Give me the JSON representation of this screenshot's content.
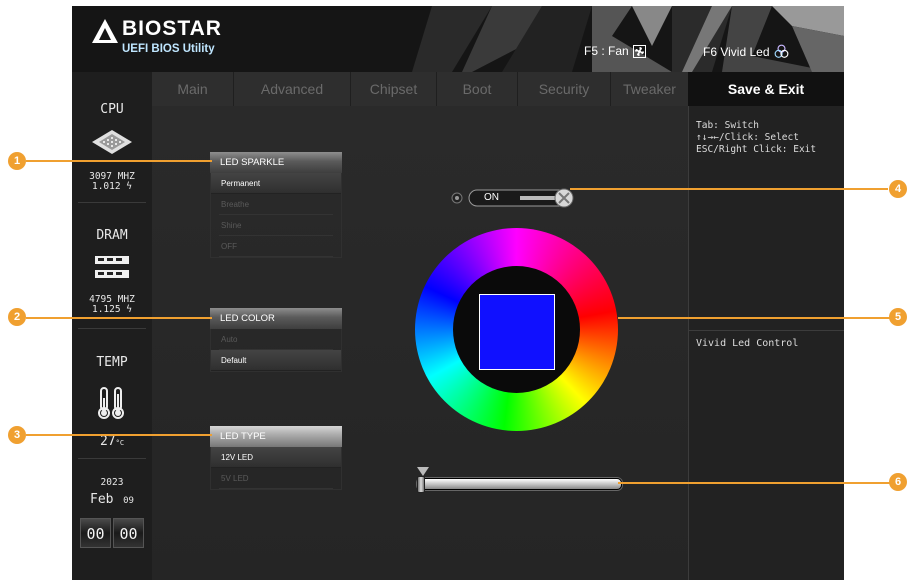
{
  "header": {
    "brand": "BIOSTAR",
    "subtitle": "UEFI BIOS Utility",
    "hotkey_fan": "F5 : Fan",
    "hotkey_led": "F6  Vivid Led"
  },
  "sidebar": {
    "cpu_title": "CPU",
    "cpu_freq": "3097 MHZ",
    "cpu_volt": "1.012 ϟ",
    "dram_title": "DRAM",
    "dram_freq": "4795 MHZ",
    "dram_volt": "1.125 ϟ",
    "temp_title": "TEMP",
    "temp_value": "27",
    "temp_unit": "°C",
    "year": "2023",
    "month": "Feb",
    "day": "09",
    "clock_hours": "00",
    "clock_minutes": "00"
  },
  "tabs": [
    "Main",
    "Advanced",
    "Chipset",
    "Boot",
    "Security",
    "Tweaker"
  ],
  "active_tab": "Save & Exit",
  "help": {
    "lines": "Tab: Switch\n↑↓→←/Click: Select\nESC/Right Click: Exit",
    "description": "Vivid Led Control"
  },
  "led_sparkle": {
    "label": "LED SPARKLE",
    "options": [
      "Permanent",
      "Breathe",
      "Shine",
      "OFF"
    ],
    "selected": "Permanent"
  },
  "led_color": {
    "label": "LED COLOR",
    "options": [
      "Auto",
      "Default"
    ],
    "selected": "Default"
  },
  "led_type": {
    "label": "LED TYPE",
    "options": [
      "12V LED",
      "5V LED"
    ],
    "selected": "12V LED"
  },
  "toggle": {
    "label": "ON",
    "state": "on"
  },
  "color_picker": {
    "selected_color": "#1010ff"
  },
  "brightness_slider": {
    "value": 0
  },
  "callouts": [
    "1",
    "2",
    "3",
    "4",
    "5",
    "6"
  ],
  "colors": {
    "callout": "#f0a030",
    "accent": "#1010ff",
    "panel": "#262626"
  }
}
